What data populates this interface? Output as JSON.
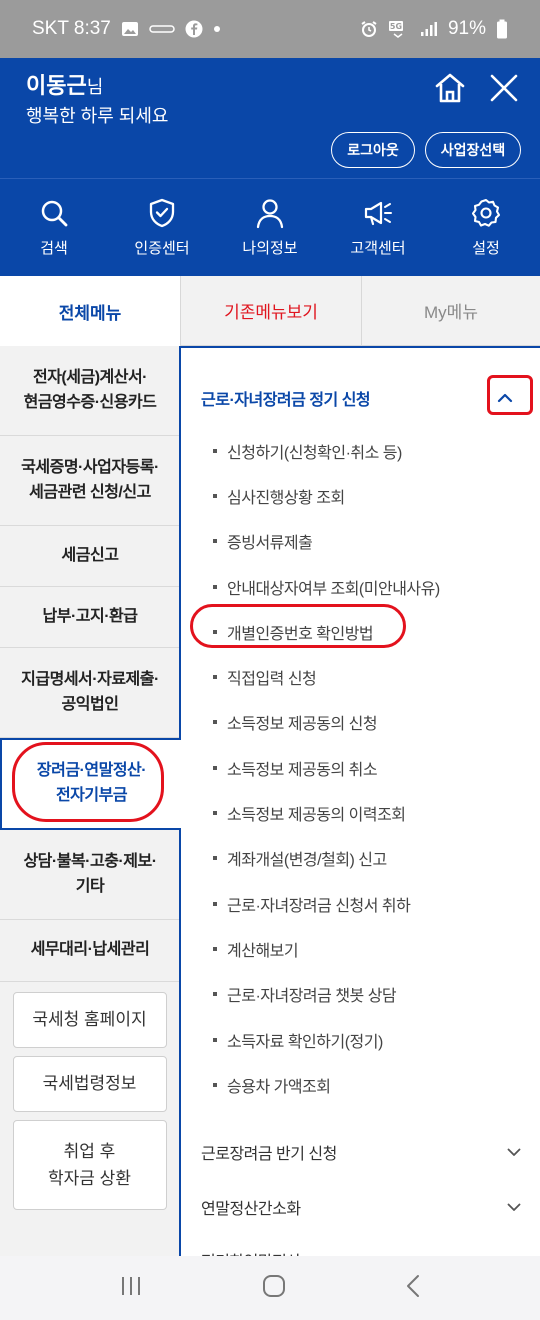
{
  "status_bar": {
    "carrier_time": "SKT 8:37",
    "battery": "91%"
  },
  "header": {
    "user_name": "이동근",
    "user_suffix": "님",
    "greeting": "행복한 하루 되세요",
    "logout_label": "로그아웃",
    "site_select_label": "사업장선택"
  },
  "quick_nav": [
    {
      "label": "검색",
      "icon": "search-icon"
    },
    {
      "label": "인증센터",
      "icon": "shield-check-icon"
    },
    {
      "label": "나의정보",
      "icon": "person-icon"
    },
    {
      "label": "고객센터",
      "icon": "megaphone-icon"
    },
    {
      "label": "설정",
      "icon": "gear-icon"
    }
  ],
  "tabs": [
    {
      "label": "전체메뉴",
      "active": true
    },
    {
      "label": "기존메뉴보기",
      "active": false
    },
    {
      "label": "My메뉴",
      "active": false
    }
  ],
  "categories": [
    {
      "label": "전자(세금)계산서·\n현금영수증·신용카드"
    },
    {
      "label": "국세증명·사업자등록·\n세금관련 신청/신고"
    },
    {
      "label": "세금신고"
    },
    {
      "label": "납부·고지·환급"
    },
    {
      "label": "지급명세서·자료제출·\n공익법인"
    },
    {
      "label": "장려금·연말정산·\n전자기부금",
      "active": true
    },
    {
      "label": "상담·불복·고충·제보·\n기타"
    },
    {
      "label": "세무대리·납세관리"
    }
  ],
  "external_links": [
    {
      "label": "국세청 홈페이지"
    },
    {
      "label": "국세법령정보"
    },
    {
      "label": "취업 후\n학자금 상환"
    }
  ],
  "submenu": {
    "open_group": "근로·자녀장려금 정기 신청",
    "items": [
      "신청하기(신청확인·취소 등)",
      "심사진행상황 조회",
      "증빙서류제출",
      "안내대상자여부 조회(미안내사유)",
      "개별인증번호 확인방법",
      "직접입력 신청",
      "소득정보 제공동의 신청",
      "소득정보 제공동의 취소",
      "소득정보 제공동의 이력조회",
      "계좌개설(변경/철회) 신고",
      "근로·자녀장려금 신청서 취하",
      "계산해보기",
      "근로·자녀장려금 챗봇 상담",
      "소득자료 확인하기(정기)",
      "승용차 가액조회"
    ],
    "closed_groups": [
      "근로장려금 반기 신청",
      "연말정산간소화",
      "편리한연말정산"
    ]
  },
  "colors": {
    "brand": "#0a47a8",
    "accent_red": "#e0151f",
    "panel_gray": "#f2f2f2"
  }
}
